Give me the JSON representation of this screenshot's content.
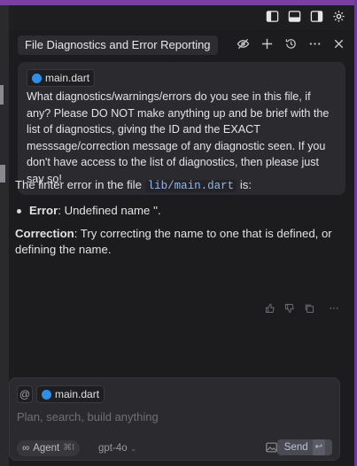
{
  "panel": {
    "title": "File Diagnostics and Error Reporting"
  },
  "user_message": {
    "file_chip": "main.dart",
    "text": "What diagnostics/warnings/errors do you see in this file, if any? Please DO NOT make anything up and be brief with the list of diagnostics, giving the ID and the EXACT messsage/correction message of any diagnostic seen. If you don't have access to the list of diagnostics, then please just say so!"
  },
  "assistant_message": {
    "intro_prefix": "The linter error in the file",
    "file_path": "lib/main.dart",
    "intro_suffix": "is:",
    "bullet_label": "Error",
    "bullet_text": ": Undefined name ''.",
    "correction_label": "Correction",
    "correction_text": ": Try correcting the name to one that is defined, or defining the name."
  },
  "composer": {
    "mention_symbol": "@",
    "file_chip": "main.dart",
    "placeholder": "Plan, search, build anything",
    "agent_label": "Agent",
    "agent_shortcut": "⌘I",
    "model": "gpt-4o",
    "send_label": "Send"
  }
}
